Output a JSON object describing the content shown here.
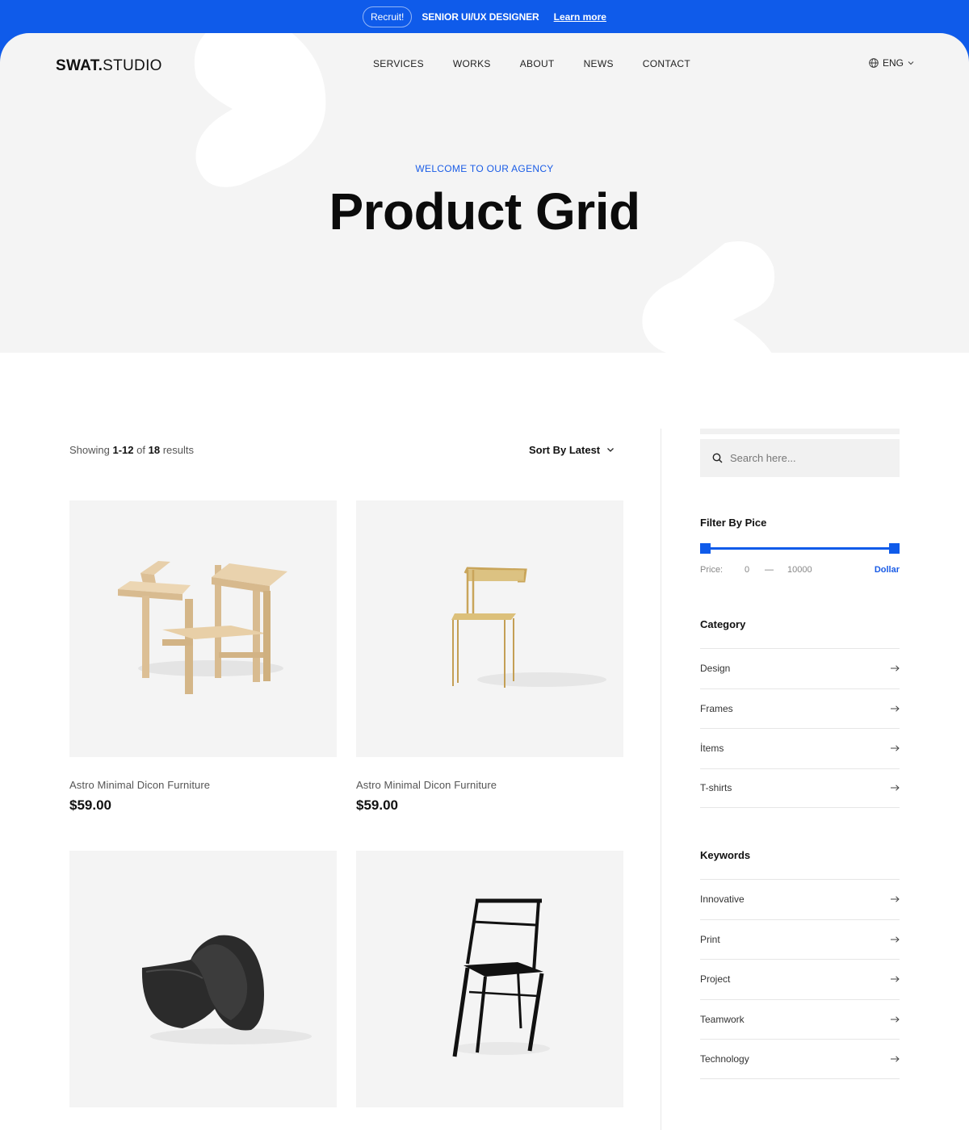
{
  "announcement": {
    "pill": "Recruit!",
    "job": "SENIOR UI/UX DESIGNER",
    "link": "Learn more"
  },
  "header": {
    "logo_bold": "SWAT.",
    "logo_light": "STUDIO",
    "nav": [
      "SERVICES",
      "WORKS",
      "ABOUT",
      "NEWS",
      "CONTACT"
    ],
    "language": "ENG"
  },
  "hero": {
    "kicker": "WELCOME TO OUR AGENCY",
    "title": "Product Grid"
  },
  "listing": {
    "results_prefix": "Showing",
    "results_range": "1-12",
    "results_of": "of",
    "results_total": "18",
    "results_suffix": "results",
    "sort_label": "Sort By Latest"
  },
  "products": [
    {
      "name": "Astro Minimal Dicon Furniture",
      "price": "$59.00",
      "image": "wooden-armchair"
    },
    {
      "name": "Astro Minimal Dicon Furniture",
      "price": "$59.00",
      "image": "gold-wire-chair"
    },
    {
      "name": "",
      "price": "",
      "image": "black-curved-stool"
    },
    {
      "name": "",
      "price": "",
      "image": "black-frame-chair"
    }
  ],
  "sidebar": {
    "search_placeholder": "Search here...",
    "filter_title": "Filter By Pice",
    "price_label": "Price:",
    "price_min": "0",
    "price_separator": "—",
    "price_max": "10000",
    "price_currency": "Dollar",
    "category_title": "Category",
    "categories": [
      "Design",
      "Frames",
      "İtems",
      "T-shirts"
    ],
    "keywords_title": "Keywords",
    "keywords": [
      "Innovative",
      "Print",
      "Project",
      "Teamwork",
      "Technology"
    ]
  },
  "colors": {
    "accent": "#0f5bea",
    "hero_bg": "#f4f4f4",
    "text": "#111111"
  }
}
